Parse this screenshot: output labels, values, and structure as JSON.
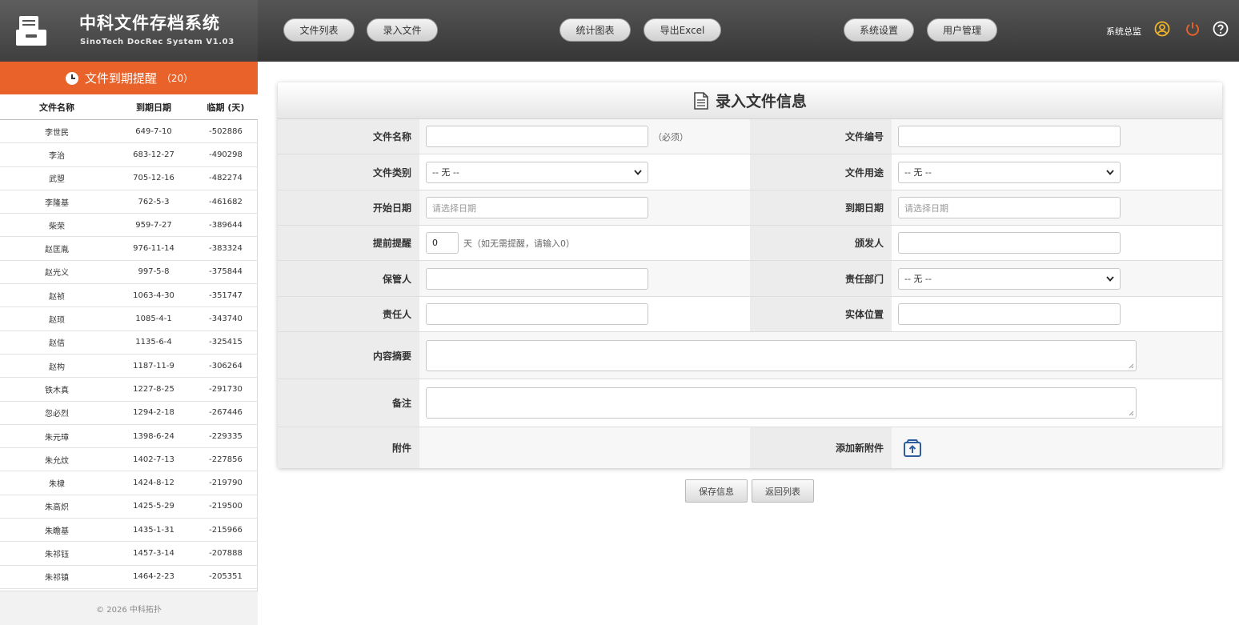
{
  "app": {
    "title": "中科文件存档系统",
    "subtitle": "SinoTech DocRec System V1.03"
  },
  "nav": [
    {
      "label": "文件列表"
    },
    {
      "label": "录入文件"
    },
    {
      "label": "统计图表"
    },
    {
      "label": "导出Excel"
    },
    {
      "label": "系统设置"
    },
    {
      "label": "用户管理"
    }
  ],
  "user": {
    "name": "系统总监",
    "icons": [
      "user-circle-icon",
      "power-icon",
      "help-icon"
    ],
    "power_color": "#e8622a"
  },
  "reminder": {
    "title": "文件到期提醒",
    "count": "（20）",
    "accent": "#e8622a",
    "columns": [
      "文件名称",
      "到期日期",
      "临期 (天)"
    ],
    "rows": [
      {
        "name": "李世民",
        "date": "649-7-10",
        "days": "-502886"
      },
      {
        "name": "李治",
        "date": "683-12-27",
        "days": "-490298"
      },
      {
        "name": "武曌",
        "date": "705-12-16",
        "days": "-482274"
      },
      {
        "name": "李隆基",
        "date": "762-5-3",
        "days": "-461682"
      },
      {
        "name": "柴荣",
        "date": "959-7-27",
        "days": "-389644"
      },
      {
        "name": "赵匡胤",
        "date": "976-11-14",
        "days": "-383324"
      },
      {
        "name": "赵光义",
        "date": "997-5-8",
        "days": "-375844"
      },
      {
        "name": "赵祯",
        "date": "1063-4-30",
        "days": "-351747"
      },
      {
        "name": "赵顼",
        "date": "1085-4-1",
        "days": "-343740"
      },
      {
        "name": "赵佶",
        "date": "1135-6-4",
        "days": "-325415"
      },
      {
        "name": "赵构",
        "date": "1187-11-9",
        "days": "-306264"
      },
      {
        "name": "铁木真",
        "date": "1227-8-25",
        "days": "-291730"
      },
      {
        "name": "忽必烈",
        "date": "1294-2-18",
        "days": "-267446"
      },
      {
        "name": "朱元璋",
        "date": "1398-6-24",
        "days": "-229335"
      },
      {
        "name": "朱允炆",
        "date": "1402-7-13",
        "days": "-227856"
      },
      {
        "name": "朱棣",
        "date": "1424-8-12",
        "days": "-219790"
      },
      {
        "name": "朱高炽",
        "date": "1425-5-29",
        "days": "-219500"
      },
      {
        "name": "朱瞻基",
        "date": "1435-1-31",
        "days": "-215966"
      },
      {
        "name": "朱祁钰",
        "date": "1457-3-14",
        "days": "-207888"
      },
      {
        "name": "朱祁镇",
        "date": "1464-2-23",
        "days": "-205351"
      }
    ]
  },
  "footer": {
    "text": "© 2026 中科拓扑"
  },
  "form": {
    "title": "录入文件信息",
    "doc_name": {
      "label": "文件名称",
      "value": "",
      "hint": "（必须）"
    },
    "doc_number": {
      "label": "文件编号",
      "value": ""
    },
    "doc_category": {
      "label": "文件类别",
      "selected": "-- 无 --"
    },
    "doc_usage": {
      "label": "文件用途",
      "selected": "-- 无 --"
    },
    "start_date": {
      "label": "开始日期",
      "placeholder": "请选择日期"
    },
    "end_date": {
      "label": "到期日期",
      "placeholder": "请选择日期"
    },
    "advance_remind": {
      "label": "提前提醒",
      "value": "0",
      "hint": "天（如无需提醒，请输入0）"
    },
    "issuer": {
      "label": "颁发人",
      "value": ""
    },
    "custodian": {
      "label": "保管人",
      "value": ""
    },
    "department": {
      "label": "责任部门",
      "selected": "-- 无 --"
    },
    "responsible": {
      "label": "责任人",
      "value": ""
    },
    "location": {
      "label": "实体位置",
      "value": ""
    },
    "summary": {
      "label": "内容摘要",
      "value": ""
    },
    "remarks": {
      "label": "备注",
      "value": ""
    },
    "attachment": {
      "label": "附件"
    },
    "add_attachment": {
      "label": "添加新附件",
      "icon": "upload-box-icon",
      "icon_color": "#2f5d9e"
    }
  },
  "actions": {
    "save": "保存信息",
    "back": "返回列表"
  }
}
